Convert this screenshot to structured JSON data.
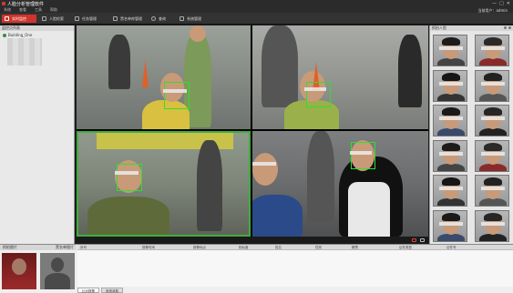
{
  "window": {
    "title": "人脸分析管理软件",
    "controls": [
      "—",
      "□",
      "✕"
    ]
  },
  "menubar": {
    "items": [
      "系统",
      "查看",
      "工具",
      "帮助"
    ],
    "user_label": "当前用户：admin"
  },
  "tabs": [
    {
      "label": "实时监控",
      "icon": "monitor-icon",
      "active": true
    },
    {
      "label": "人脸检索",
      "icon": "face-search-icon"
    },
    {
      "label": "任务管理",
      "icon": "task-icon"
    },
    {
      "label": "黑名单库管理",
      "icon": "database-icon"
    },
    {
      "label": "查询",
      "icon": "search-icon"
    },
    {
      "label": "系统管理",
      "icon": "settings-icon"
    }
  ],
  "left_panel": {
    "title": "监控点列表",
    "tree_root": "Building_One"
  },
  "snapshot_panel": {
    "title": "抓拍人脸",
    "count": 12
  },
  "bottom": {
    "compare_left_label": "抓拍图片",
    "compare_right_label": "黑名单图片",
    "columns": [
      "序号",
      "报警时间",
      "报警地点",
      "相似度",
      "姓名",
      "性别",
      "籍贯",
      "证件类型",
      "证件号"
    ],
    "tabs": [
      "比对报警",
      "系统消息"
    ]
  },
  "colors": {
    "accent_red": "#d0342c",
    "detection_green": "#2fe02f",
    "selected_cell_border": "#3fae3f"
  }
}
